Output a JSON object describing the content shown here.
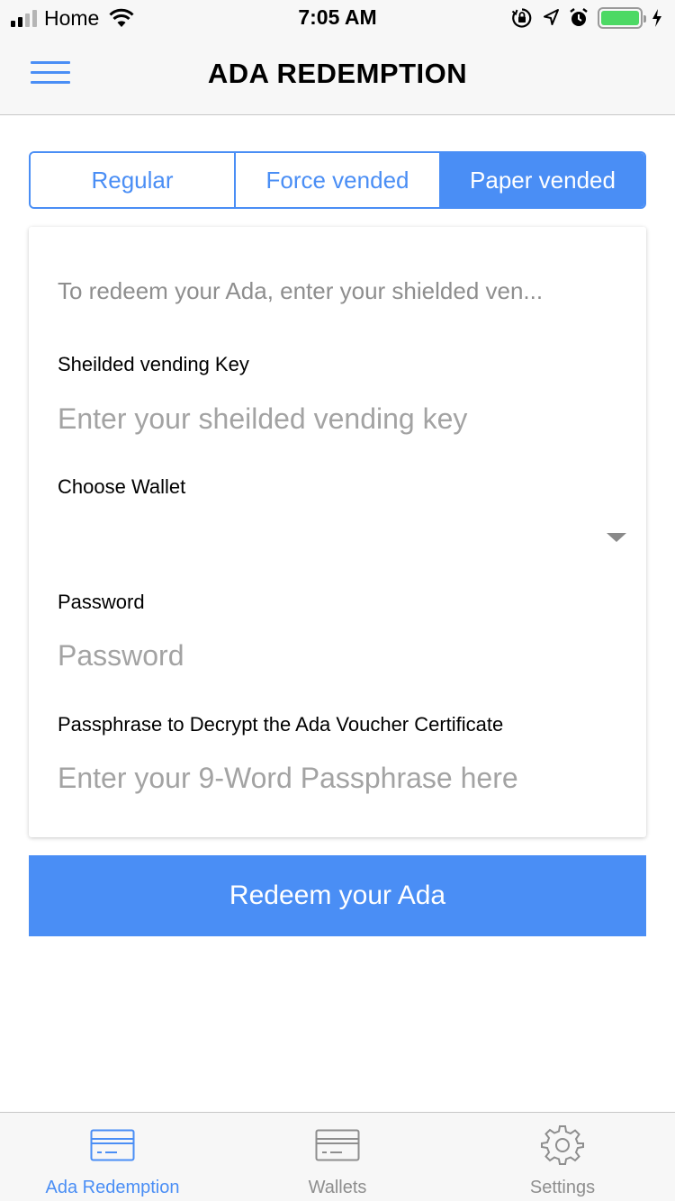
{
  "status_bar": {
    "carrier": "Home",
    "time": "7:05 AM",
    "battery_level": 1.0,
    "icons": [
      "signal-icon",
      "wifi-icon",
      "orientation-lock-icon",
      "location-icon",
      "alarm-icon",
      "battery-icon",
      "charging-icon"
    ]
  },
  "nav": {
    "title": "ADA REDEMPTION",
    "menu_icon": "hamburger-menu-icon"
  },
  "tabs_top": [
    {
      "label": "Regular",
      "active": false
    },
    {
      "label": "Force vended",
      "active": false
    },
    {
      "label": "Paper vended",
      "active": true
    }
  ],
  "form": {
    "intro": "To redeem your Ada, enter your shielded ven...",
    "vending_key": {
      "label": "Sheilded vending Key",
      "placeholder": "Enter your sheilded vending key",
      "value": ""
    },
    "wallet": {
      "label": "Choose Wallet",
      "value": ""
    },
    "password": {
      "label": "Password",
      "placeholder": "Password",
      "value": ""
    },
    "passphrase": {
      "label": "Passphrase to Decrypt the Ada Voucher Certificate",
      "placeholder": "Enter your 9-Word Passphrase here",
      "value": ""
    }
  },
  "redeem_button": "Redeem your Ada",
  "tab_bar": [
    {
      "label": "Ada Redemption",
      "icon": "card-icon",
      "active": true
    },
    {
      "label": "Wallets",
      "icon": "wallet-card-icon",
      "active": false
    },
    {
      "label": "Settings",
      "icon": "gear-icon",
      "active": false
    }
  ],
  "colors": {
    "accent": "#4a8ef5",
    "placeholder": "#a3a3a3",
    "bar_background": "#f7f7f7",
    "battery": "#4cd964"
  }
}
